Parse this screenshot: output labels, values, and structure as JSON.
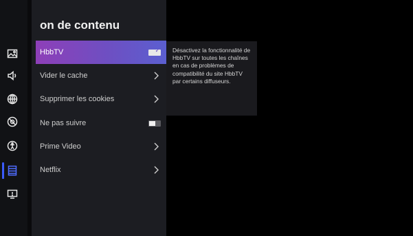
{
  "page_title": "on de contenu",
  "menu": {
    "items": [
      {
        "label": "HbbTV",
        "control": "toggle",
        "state": "on",
        "selected": true
      },
      {
        "label": "Vider le cache",
        "control": "chevron"
      },
      {
        "label": "Supprimer les cookies",
        "control": "chevron"
      },
      {
        "label": "Ne pas suivre",
        "control": "toggle",
        "state": "off"
      },
      {
        "label": "Prime Video",
        "control": "chevron"
      },
      {
        "label": "Netflix",
        "control": "chevron"
      }
    ]
  },
  "tooltip": {
    "text": "Désactivez la fonctionnalité de HbbTV sur toutes les chaînes en cas de problèmes de compatibilité du site HbbTV par certains diffuseurs."
  },
  "sidebar": {
    "icons": [
      "picture-icon",
      "sound-icon",
      "network-icon",
      "accessibility-off-icon",
      "accessibility-icon",
      "content-list-icon",
      "support-icon"
    ],
    "active_index": 5
  },
  "colors": {
    "accent": "#3b5bff",
    "selected_gradient_start": "#8e3fb8",
    "selected_gradient_end": "#5b5fd0"
  }
}
